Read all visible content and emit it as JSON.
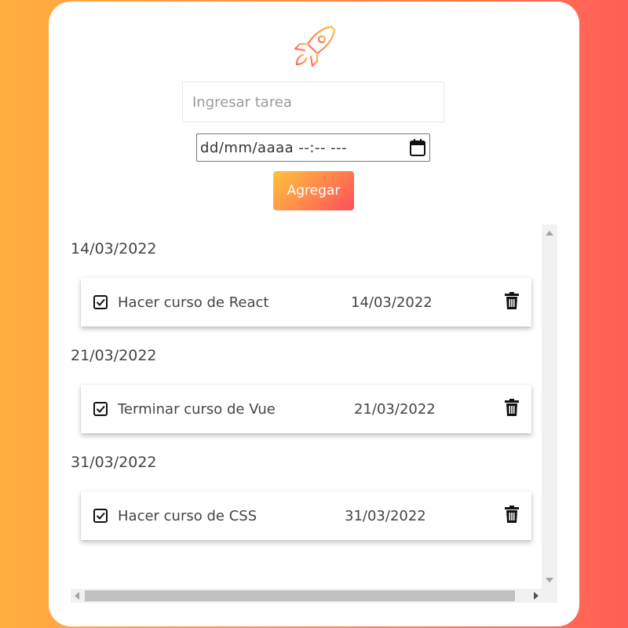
{
  "form": {
    "task_placeholder": "Ingresar tarea",
    "date_placeholder": "dd/mm/aaaa --:-- ---",
    "add_label": "Agregar"
  },
  "icons": {
    "logo": "rocket-icon",
    "date": "calendar-icon",
    "check": "checkbox-checked-icon",
    "delete": "trash-icon"
  },
  "groups": [
    {
      "date": "14/03/2022",
      "tasks": [
        {
          "title": "Hacer curso de React",
          "date": "14/03/2022",
          "done": true
        }
      ]
    },
    {
      "date": "21/03/2022",
      "tasks": [
        {
          "title": "Terminar curso de Vue",
          "date": "21/03/2022",
          "done": true
        }
      ]
    },
    {
      "date": "31/03/2022",
      "tasks": [
        {
          "title": "Hacer curso de CSS",
          "date": "31/03/2022",
          "done": true
        }
      ]
    }
  ],
  "colors": {
    "gradient_start": "#ffae3f",
    "gradient_end": "#ff5f55",
    "button_start": "#ffc33e",
    "button_end": "#ff4d5d"
  }
}
